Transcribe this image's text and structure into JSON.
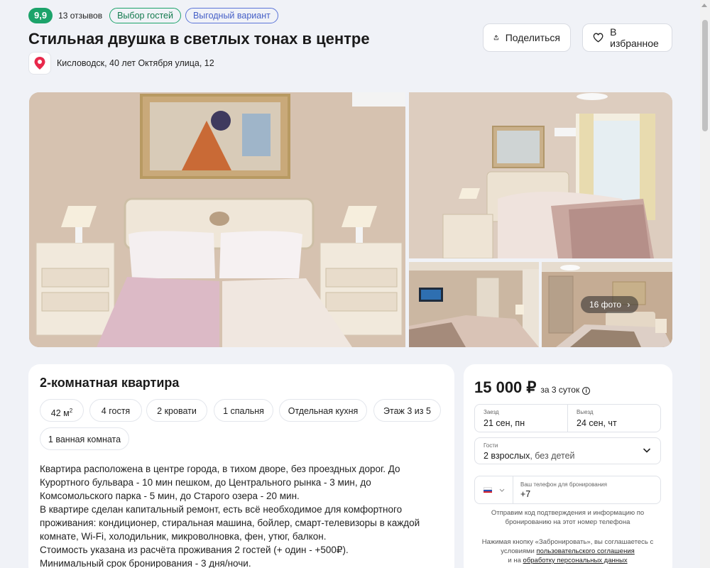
{
  "header": {
    "rating": "9,9",
    "reviews": "13 отзывов",
    "tag_guest_choice": "Выбор гостей",
    "tag_good_deal": "Выгодный вариант",
    "title": "Стильная двушка в светлых тонах в центре",
    "address": "Кисловодск, 40 лет Октября улица, 12",
    "share_label": "Поделиться",
    "favorite_label": "В избранное"
  },
  "gallery": {
    "photo_count": "16 фото"
  },
  "listing": {
    "apartment_type": "2-комнатная квартира",
    "area_value": "42 м",
    "area_sup": "2",
    "features": [
      "4 гостя",
      "2 кровати",
      "1 спальня",
      "Отдельная кухня",
      "Этаж 3 из 5",
      "1 ванная комната"
    ],
    "description": [
      "Квартира расположена в центре города, в тихом дворе, без проездных дорог. До",
      "Курортного бульвара - 10 мин пешком, до Центрального рынка - 3 мин, до",
      "Комсомольского парка - 5 мин, до Старого озера - 20 мин.",
      "В квартире сделан капитальный ремонт, есть всё необходимое для комфортного",
      "проживания: кондиционер, стиральная машина, бойлер, смарт-телевизоры в каждой",
      "комнате, Wi-Fi, холодильник, микроволновка, фен, утюг, балкон.",
      "Стоимость указана из расчёта проживания 2 гостей (+ один - +500₽).",
      "Минимальный срок бронирования - 3 дня/ночи."
    ]
  },
  "booking": {
    "price": "15 000 ₽",
    "period": "за 3 суток",
    "checkin_label": "Заезд",
    "checkin_value": "21 сен, пн",
    "checkout_label": "Выезд",
    "checkout_value": "24 сен, чт",
    "guests_label": "Гости",
    "guests_adults": "2 взрослых",
    "guests_children": ", без детей",
    "phone_label": "Ваш телефон для бронирования",
    "phone_value": "+7",
    "sms_note_1": "Отправим код подтверждения и информацию по",
    "sms_note_2": "бронированию на этот номер телефона",
    "agree_1": "Нажимая кнопку «Забронировать», вы соглашаетесь с",
    "agree_2_prefix": "условиями ",
    "agree_2_link": "пользовательского соглашения",
    "agree_3_prefix": "и на ",
    "agree_3_link": "обработку персональных данных"
  },
  "colors": {
    "rating_green": "#1ca36a",
    "deal_blue": "#4660c7",
    "page_bg": "#f0f2f7"
  }
}
